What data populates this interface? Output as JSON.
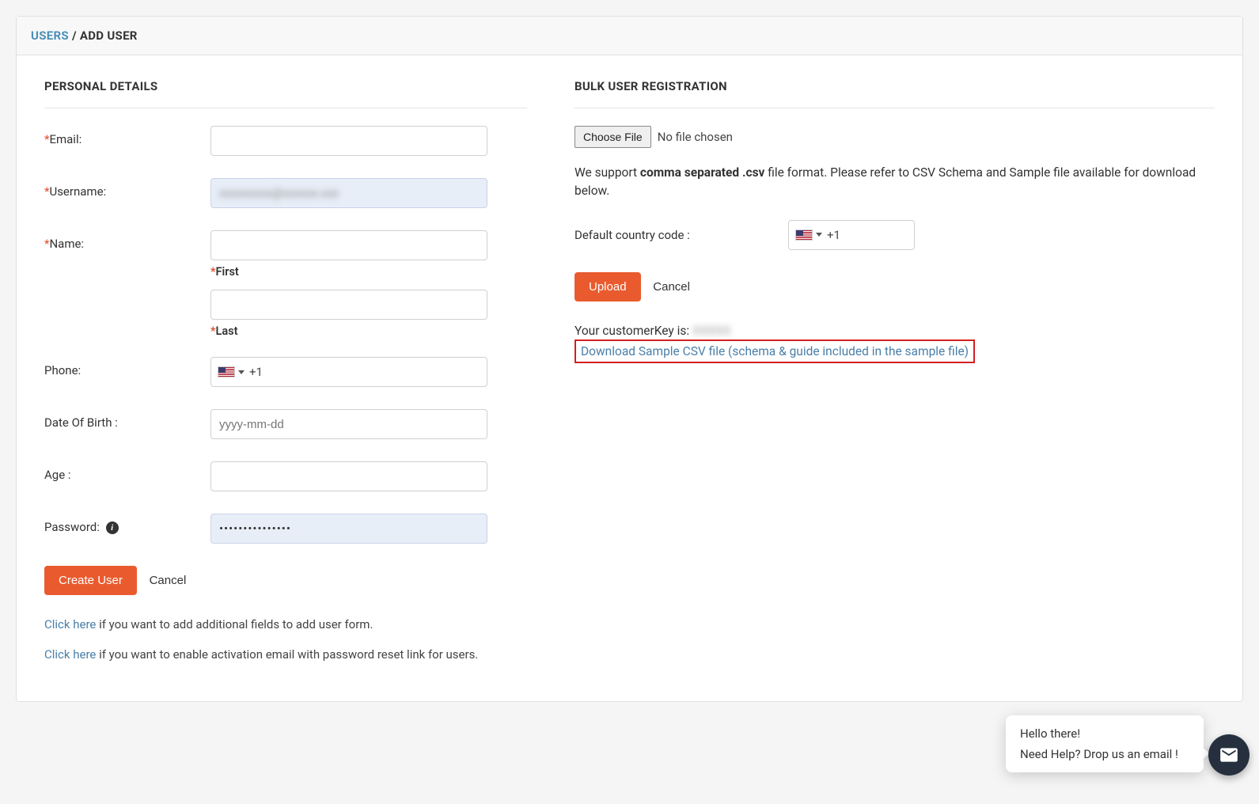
{
  "breadcrumb": {
    "parent": "USERS",
    "separator": "/",
    "current": "ADD USER"
  },
  "personal": {
    "section_title": "PERSONAL DETAILS",
    "email_label": "Email:",
    "username_label": "Username:",
    "username_value": "xxxxxxxxx@xxxxxx.xxx",
    "name_label": "Name:",
    "first_sublabel": "First",
    "last_sublabel": "Last",
    "phone_label": "Phone:",
    "phone_code": "+1",
    "dob_label": "Date Of Birth :",
    "dob_placeholder": "yyyy-mm-dd",
    "age_label": "Age :",
    "password_label": "Password:",
    "password_value": "•••••••••••••••",
    "create_btn": "Create User",
    "cancel_btn": "Cancel",
    "helper1_link": "Click here",
    "helper1_text": " if you want to add additional fields to add user form.",
    "helper2_link": "Click here",
    "helper2_text": " if you want to enable activation email with password reset link for users."
  },
  "bulk": {
    "section_title": "BULK USER REGISTRATION",
    "choose_file_btn": "Choose File",
    "no_file": "No file chosen",
    "support_prefix": "We support ",
    "support_bold": "comma separated .csv",
    "support_suffix": " file format. Please refer to CSV Schema and Sample file available for download below.",
    "cc_label": "Default country code :",
    "cc_value": "+1",
    "upload_btn": "Upload",
    "cancel_btn": "Cancel",
    "ck_prefix": "Your customerKey is: ",
    "ck_value": "XXXXX",
    "download_link": "Download Sample CSV file (schema & guide included in the sample file)"
  },
  "chat": {
    "line1": "Hello there!",
    "line2": "Need Help? Drop us an email !"
  }
}
